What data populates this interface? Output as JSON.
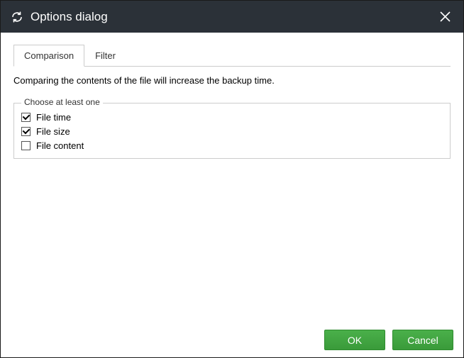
{
  "titlebar": {
    "title": "Options dialog"
  },
  "tabs": {
    "comparison": "Comparison",
    "filter": "Filter"
  },
  "comparison_panel": {
    "description": "Comparing the contents of the file will increase the backup time.",
    "fieldset_legend": "Choose at least one",
    "options": {
      "file_time": {
        "label": "File time",
        "checked": true
      },
      "file_size": {
        "label": "File size",
        "checked": true
      },
      "file_content": {
        "label": "File content",
        "checked": false
      }
    }
  },
  "buttons": {
    "ok": "OK",
    "cancel": "Cancel"
  }
}
